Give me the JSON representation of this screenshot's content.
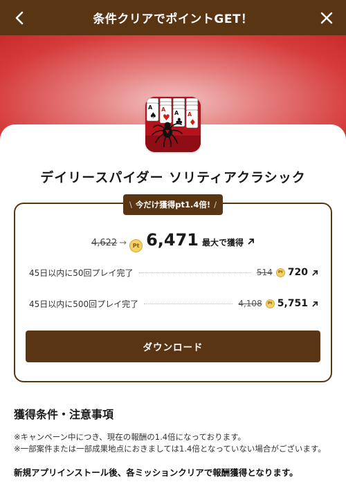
{
  "header": {
    "title": "条件クリアでポイントGET！",
    "back_icon": "chevron-left-icon",
    "close_icon": "close-icon"
  },
  "app": {
    "title": "デイリースパイダー ソリティアクラシック",
    "icon": "spider-solitaire-app-icon"
  },
  "badge": {
    "left_slash": "\\",
    "text": "今だけ獲得pt1.4倍!",
    "right_slash": "/"
  },
  "main_reward": {
    "old": "4,622",
    "arrow": "→",
    "coin": "Pt",
    "new": "6,471",
    "suffix": "最大で獲得"
  },
  "missions": [
    {
      "label": "45日以内に50回プレイ完了",
      "old": "514",
      "coin": "Pt",
      "new": "720"
    },
    {
      "label": "45日以内に500回プレイ完了",
      "old": "4,108",
      "coin": "Pt",
      "new": "5,751"
    }
  ],
  "download_label": "ダウンロード",
  "conditions": {
    "title": "獲得条件・注意事項",
    "note1": "※キャンペーン中につき、現在の報酬の1.4倍になっております。",
    "note2": "※一部案件または一部成果地点におきましては1.4倍となっていない場合がございます。",
    "note3": "新規アプリインストール後、各ミッションクリアで報酬獲得となります。"
  },
  "colors": {
    "brand_brown": "#5a3514",
    "hero_red": "#d63c3c",
    "coin_gold": "#f2d16a"
  }
}
